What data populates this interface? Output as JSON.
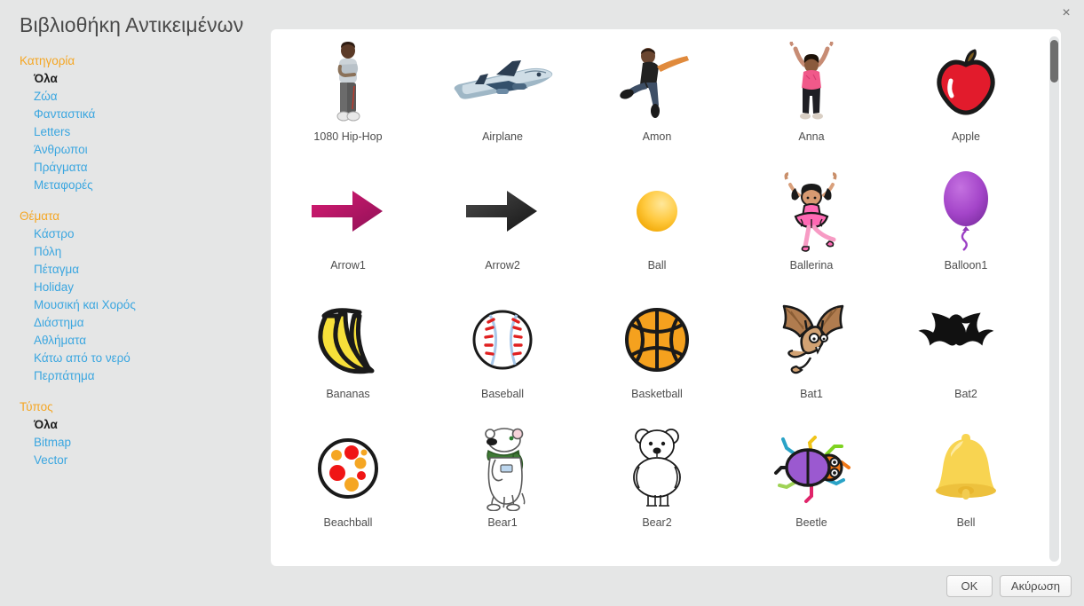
{
  "window": {
    "title": "Βιβλιοθήκη Αντικειμένων",
    "close_label": "×"
  },
  "colors": {
    "background": "#e5e6e6",
    "panel": "#ffffff",
    "group_heading": "#f5a623",
    "link": "#3aa6e0",
    "selected": "#1c1c1c",
    "title_text": "#4a4a4a",
    "scrollbar_thumb": "#6e6e6e"
  },
  "sidebar": {
    "groups": [
      {
        "title": "Κατηγορία",
        "items": [
          {
            "label": "Όλα",
            "selected": true
          },
          {
            "label": "Ζώα",
            "selected": false
          },
          {
            "label": "Φανταστικά",
            "selected": false
          },
          {
            "label": "Letters",
            "selected": false
          },
          {
            "label": "Άνθρωποι",
            "selected": false
          },
          {
            "label": "Πράγματα",
            "selected": false
          },
          {
            "label": "Μεταφορές",
            "selected": false
          }
        ]
      },
      {
        "title": "Θέματα",
        "items": [
          {
            "label": "Κάστρο",
            "selected": false
          },
          {
            "label": "Πόλη",
            "selected": false
          },
          {
            "label": "Πέταγμα",
            "selected": false
          },
          {
            "label": "Holiday",
            "selected": false
          },
          {
            "label": "Μουσική και Χορός",
            "selected": false
          },
          {
            "label": "Διάστημα",
            "selected": false
          },
          {
            "label": "Αθλήματα",
            "selected": false
          },
          {
            "label": "Κάτω από το νερό",
            "selected": false
          },
          {
            "label": "Περπάτημα",
            "selected": false
          }
        ]
      },
      {
        "title": "Τύπος",
        "items": [
          {
            "label": "Όλα",
            "selected": true
          },
          {
            "label": "Bitmap",
            "selected": false
          },
          {
            "label": "Vector",
            "selected": false
          }
        ]
      }
    ]
  },
  "library": {
    "items": [
      {
        "label": "1080 Hip-Hop",
        "icon": "hiphop-dancer-icon"
      },
      {
        "label": "Airplane",
        "icon": "airplane-icon"
      },
      {
        "label": "Amon",
        "icon": "amon-dancer-icon"
      },
      {
        "label": "Anna",
        "icon": "anna-dancer-icon"
      },
      {
        "label": "Apple",
        "icon": "apple-icon"
      },
      {
        "label": "Arrow1",
        "icon": "arrow-magenta-icon"
      },
      {
        "label": "Arrow2",
        "icon": "arrow-dark-icon"
      },
      {
        "label": "Ball",
        "icon": "ball-icon"
      },
      {
        "label": "Ballerina",
        "icon": "ballerina-icon"
      },
      {
        "label": "Balloon1",
        "icon": "balloon-purple-icon"
      },
      {
        "label": "Bananas",
        "icon": "bananas-icon"
      },
      {
        "label": "Baseball",
        "icon": "baseball-icon"
      },
      {
        "label": "Basketball",
        "icon": "basketball-icon"
      },
      {
        "label": "Bat1",
        "icon": "bat-brown-icon"
      },
      {
        "label": "Bat2",
        "icon": "bat-black-icon"
      },
      {
        "label": "Beachball",
        "icon": "beachball-icon"
      },
      {
        "label": "Bear1",
        "icon": "polar-bear-scarf-icon"
      },
      {
        "label": "Bear2",
        "icon": "bear-outline-icon"
      },
      {
        "label": "Beetle",
        "icon": "beetle-icon"
      },
      {
        "label": "Bell",
        "icon": "bell-icon"
      }
    ]
  },
  "scrollbar": {
    "thumb_position_percent": 1,
    "thumb_size_percent": 8
  },
  "footer": {
    "ok_label": "OK",
    "cancel_label": "Ακύρωση"
  }
}
